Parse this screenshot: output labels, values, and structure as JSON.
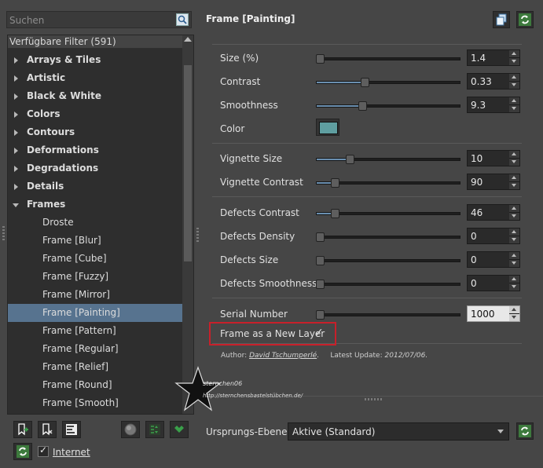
{
  "search": {
    "placeholder": "Suchen"
  },
  "filter_tree": {
    "header": "Verfügbare Filter (591)",
    "categories": [
      {
        "label": "Arrays & Tiles"
      },
      {
        "label": "Artistic"
      },
      {
        "label": "Black & White"
      },
      {
        "label": "Colors"
      },
      {
        "label": "Contours"
      },
      {
        "label": "Deformations"
      },
      {
        "label": "Degradations"
      },
      {
        "label": "Details"
      },
      {
        "label": "Frames"
      }
    ],
    "frames_children": [
      {
        "label": "Droste"
      },
      {
        "label": "Frame [Blur]"
      },
      {
        "label": "Frame [Cube]"
      },
      {
        "label": "Frame [Fuzzy]"
      },
      {
        "label": "Frame [Mirror]"
      },
      {
        "label": "Frame [Painting]"
      },
      {
        "label": "Frame [Pattern]"
      },
      {
        "label": "Frame [Regular]"
      },
      {
        "label": "Frame [Relief]"
      },
      {
        "label": "Frame [Round]"
      },
      {
        "label": "Frame [Smooth]"
      }
    ],
    "selected": "Frame [Painting]"
  },
  "bottom_left": {
    "internet_label": "Internet",
    "internet_checked": true,
    "icons": [
      "add-favorite-icon",
      "remove-favorite-icon",
      "rename-icon",
      "globe-icon",
      "expand-collapse-icon",
      "update-icon"
    ]
  },
  "panel": {
    "title": "Frame [Painting]",
    "params": {
      "size": {
        "label": "Size (%)",
        "value": "1.4",
        "level": 0.0
      },
      "contrast": {
        "label": "Contrast",
        "value": "0.33",
        "level": 0.33
      },
      "smoothness": {
        "label": "Smoothness",
        "value": "9.3",
        "level": 0.31
      },
      "color": {
        "label": "Color",
        "hex": "#5f9ea0"
      },
      "vignette_size": {
        "label": "Vignette Size",
        "value": "10",
        "level": 0.22
      },
      "vignette_contrast": {
        "label": "Vignette Contrast",
        "value": "90",
        "level": 0.11
      },
      "defects_contrast": {
        "label": "Defects Contrast",
        "value": "46",
        "level": 0.11
      },
      "defects_density": {
        "label": "Defects Density",
        "value": "0",
        "level": 0.0
      },
      "defects_size": {
        "label": "Defects Size",
        "value": "0",
        "level": 0.0
      },
      "defects_smoothness": {
        "label": "Defects Smoothness",
        "value": "0",
        "level": 0.0
      },
      "serial_number": {
        "label": "Serial Number",
        "value": "1000",
        "level": 0.0
      },
      "new_layer": {
        "label": "Frame as a New Layer",
        "checked": true
      }
    },
    "author_prefix": "Author:",
    "author_name": "David Tschumperlé",
    "update_text": "Latest Update:",
    "update_date": "2012/07/06."
  },
  "bottom_right": {
    "source_label": "Ursprungs-Ebenen",
    "source_value": "Aktive (Standard)"
  },
  "watermark": {
    "line1": "sternchen06",
    "line2": "http://sternchensbastelstübchen.de/"
  },
  "colors": {
    "accent": "#57738f",
    "highlight_box": "#c8202a",
    "icon_green": "#3aa04a"
  }
}
